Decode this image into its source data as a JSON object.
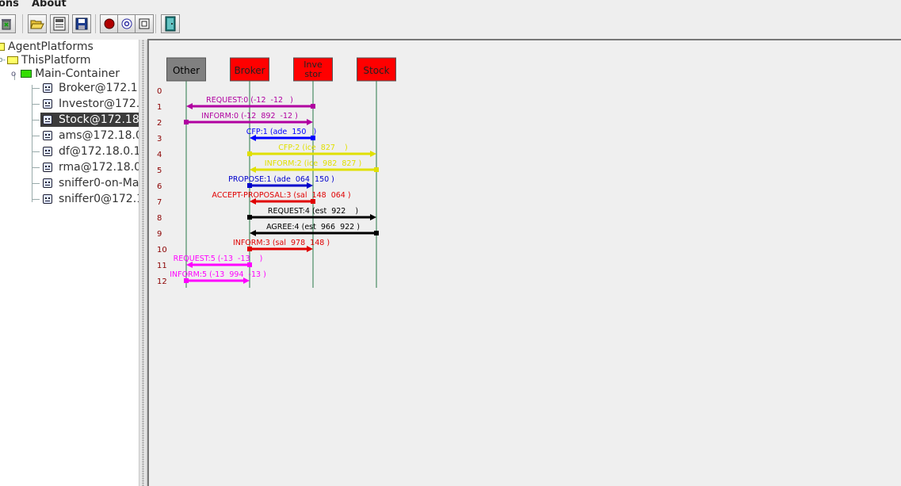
{
  "menubar": {
    "items": [
      "ons",
      "About"
    ]
  },
  "toolbar": {
    "buttons": [
      {
        "icon": "trash-icon"
      },
      {
        "icon": "open-folder-icon"
      },
      {
        "icon": "save-list-icon"
      },
      {
        "icon": "floppy-disk-icon"
      },
      {
        "icon": "record-icon"
      },
      {
        "icon": "at-sign-icon"
      },
      {
        "icon": "filter-icon"
      },
      {
        "icon": "exit-door-icon"
      }
    ]
  },
  "tree": {
    "root": "AgentPlatforms",
    "platform": "ThisPlatform",
    "container": "Main-Container",
    "agents": [
      {
        "label": "Broker@172.1"
      },
      {
        "label": "Investor@172."
      },
      {
        "label": "Stock@172.18",
        "selected": true
      },
      {
        "label": "ams@172.18.0"
      },
      {
        "label": "df@172.18.0.1"
      },
      {
        "label": "rma@172.18.0"
      },
      {
        "label": "sniffer0-on-Ma"
      },
      {
        "label": "sniffer0@172.1"
      }
    ]
  },
  "sequence": {
    "agents": [
      {
        "label1": "Other",
        "label2": "",
        "color": "#808080"
      },
      {
        "label1": "Broker",
        "label2": "",
        "color": "#ff0000"
      },
      {
        "label1": "Inve",
        "label2": "stor",
        "color": "#ff0000"
      },
      {
        "label1": "Stock",
        "label2": "",
        "color": "#ff0000"
      }
    ],
    "row_numbers": [
      "0",
      "1",
      "2",
      "3",
      "4",
      "5",
      "6",
      "7",
      "8",
      "9",
      "10",
      "11",
      "12"
    ],
    "messages": [
      {
        "row": 1,
        "from": 2,
        "to": 0,
        "label": "REQUEST:0 (-12  -12   )",
        "color": "#b000a0"
      },
      {
        "row": 2,
        "from": 0,
        "to": 2,
        "label": "INFORM:0 (-12  892  -12 )",
        "color": "#b000a0"
      },
      {
        "row": 3,
        "from": 2,
        "to": 1,
        "label": "CFP:1 (ade  150   )",
        "color": "#0000ff"
      },
      {
        "row": 4,
        "from": 1,
        "to": 3,
        "label": "CFP:2 (ice  827    )",
        "color": "#e0e000"
      },
      {
        "row": 5,
        "from": 3,
        "to": 1,
        "label": "INFORM:2 (ice  982  827 )",
        "color": "#e0e000"
      },
      {
        "row": 6,
        "from": 1,
        "to": 2,
        "label": "PROPOSE:1 (ade  064  150 )",
        "color": "#0000cc"
      },
      {
        "row": 7,
        "from": 2,
        "to": 1,
        "label": "ACCEPT-PROPOSAL:3 (sal  148  064 )",
        "color": "#e00000"
      },
      {
        "row": 8,
        "from": 1,
        "to": 3,
        "label": "REQUEST:4 (est  922    )",
        "color": "#000000"
      },
      {
        "row": 9,
        "from": 3,
        "to": 1,
        "label": "AGREE:4 (est  966  922 )",
        "color": "#000000"
      },
      {
        "row": 10,
        "from": 1,
        "to": 2,
        "label": "INFORM:3 (sal  978  148 )",
        "color": "#e00000"
      },
      {
        "row": 11,
        "from": 1,
        "to": 0,
        "label": "REQUEST:5 (-13  -13    )",
        "color": "#ff00ff"
      },
      {
        "row": 12,
        "from": 0,
        "to": 1,
        "label": "INFORM:5 (-13  994  -13 )",
        "color": "#ff00ff"
      }
    ]
  }
}
